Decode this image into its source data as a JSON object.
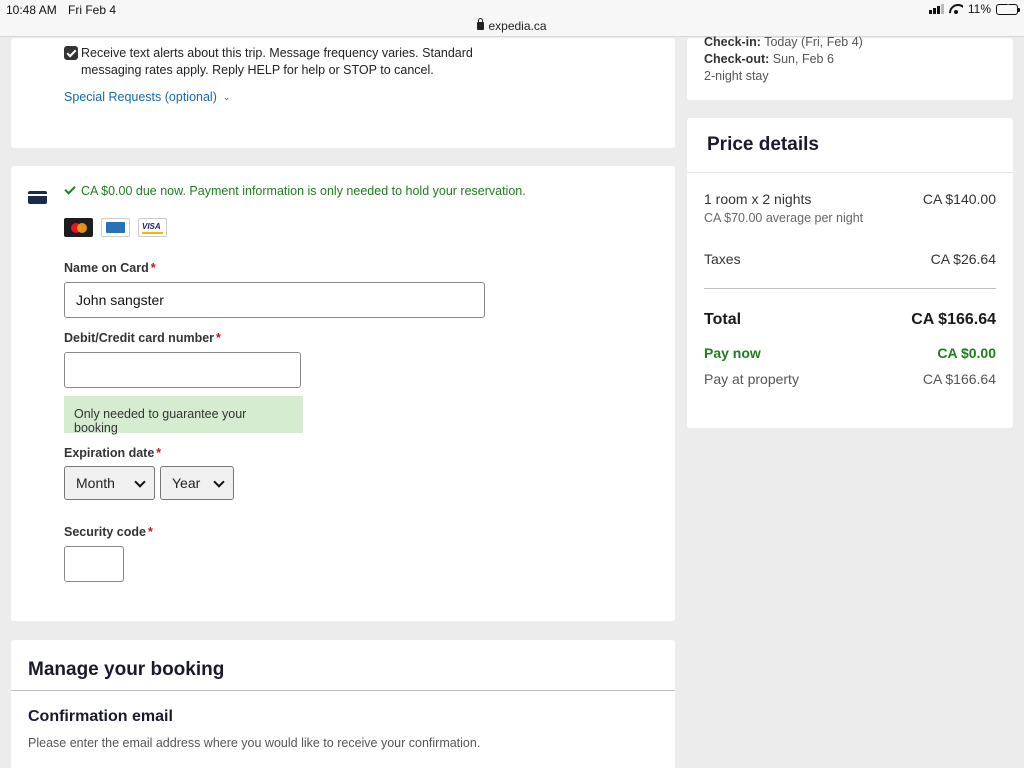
{
  "status_bar": {
    "time": "10:48 AM",
    "date": "Fri Feb 4",
    "url": "expedia.ca",
    "battery": "11%"
  },
  "sms": {
    "checked": true,
    "text": "Receive text alerts about this trip. Message frequency varies. Standard messaging rates apply. Reply HELP for help or STOP to cancel."
  },
  "special_requests": "Special Requests (optional)",
  "payment": {
    "due_now": "CA $0.00 due now. Payment information is only needed to hold your reservation.",
    "brands": [
      "mastercard-icon",
      "amex-icon",
      "visa-icon"
    ],
    "visa_text": "VISA",
    "name_label": "Name on Card",
    "name_value": "John sangster",
    "card_number_label": "Debit/Credit card number",
    "card_number_value": "",
    "hint": "Only needed to guarantee your booking",
    "expiration_label": "Expiration date",
    "month": "Month",
    "year": "Year",
    "security_label": "Security code",
    "security_value": "",
    "required_mark": "*"
  },
  "manage": {
    "title": "Manage your booking",
    "confirmation_title": "Confirmation email",
    "confirmation_sub": "Please enter the email address where you would like to receive your confirmation."
  },
  "stay": {
    "checkin_label": "Check-in:",
    "checkin_value": "Today (Fri, Feb 4)",
    "checkout_label": "Check-out:",
    "checkout_value": "Sun, Feb 6",
    "length": "2-night stay"
  },
  "price": {
    "title": "Price details",
    "room_label": "1 room x 2 nights",
    "room_value": "CA $140.00",
    "avg": "CA $70.00 average per night",
    "taxes_label": "Taxes",
    "taxes_value": "CA $26.64",
    "total_label": "Total",
    "total_value": "CA $166.64",
    "pay_now_label": "Pay now",
    "pay_now_value": "CA $0.00",
    "pay_property_label": "Pay at property",
    "pay_property_value": "CA $166.64"
  },
  "colors": {
    "link": "#1668b3",
    "success": "#1e7e1e",
    "hint_bg": "#d5ecd0",
    "required": "#c4151c",
    "page_bg": "#ececec"
  }
}
